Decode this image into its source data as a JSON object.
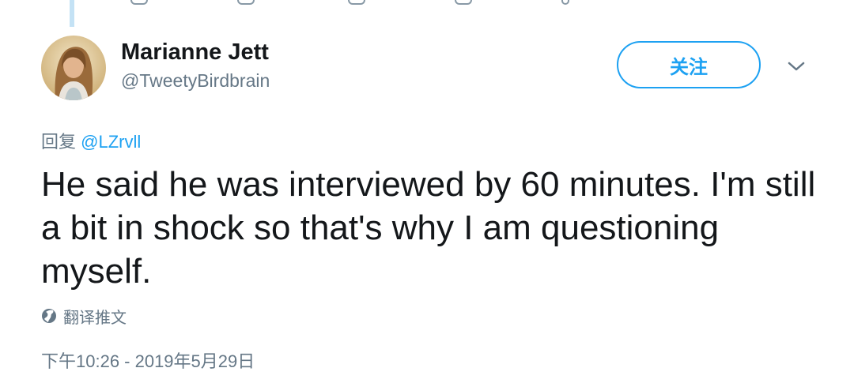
{
  "user": {
    "display_name": "Marianne Jett",
    "handle": "@TweetyBirdbrain"
  },
  "follow_button": {
    "label": "关注"
  },
  "reply": {
    "prefix": "回复",
    "mention": "@LZrvll"
  },
  "tweet": {
    "text": "He said he was interviewed by 60 minutes. I'm still a bit in shock so that's why I am questioning myself."
  },
  "translate": {
    "label": "翻译推文",
    "icon": "globe-icon"
  },
  "timestamp": "下午10:26 - 2019年5月29日",
  "icons": {
    "menu": "chevron-down-icon",
    "thread": "thread-line"
  },
  "colors": {
    "accent": "#1da1f2",
    "secondary_text": "#657786",
    "primary_text": "#14171a",
    "thread_line": "#c4e2f5"
  }
}
